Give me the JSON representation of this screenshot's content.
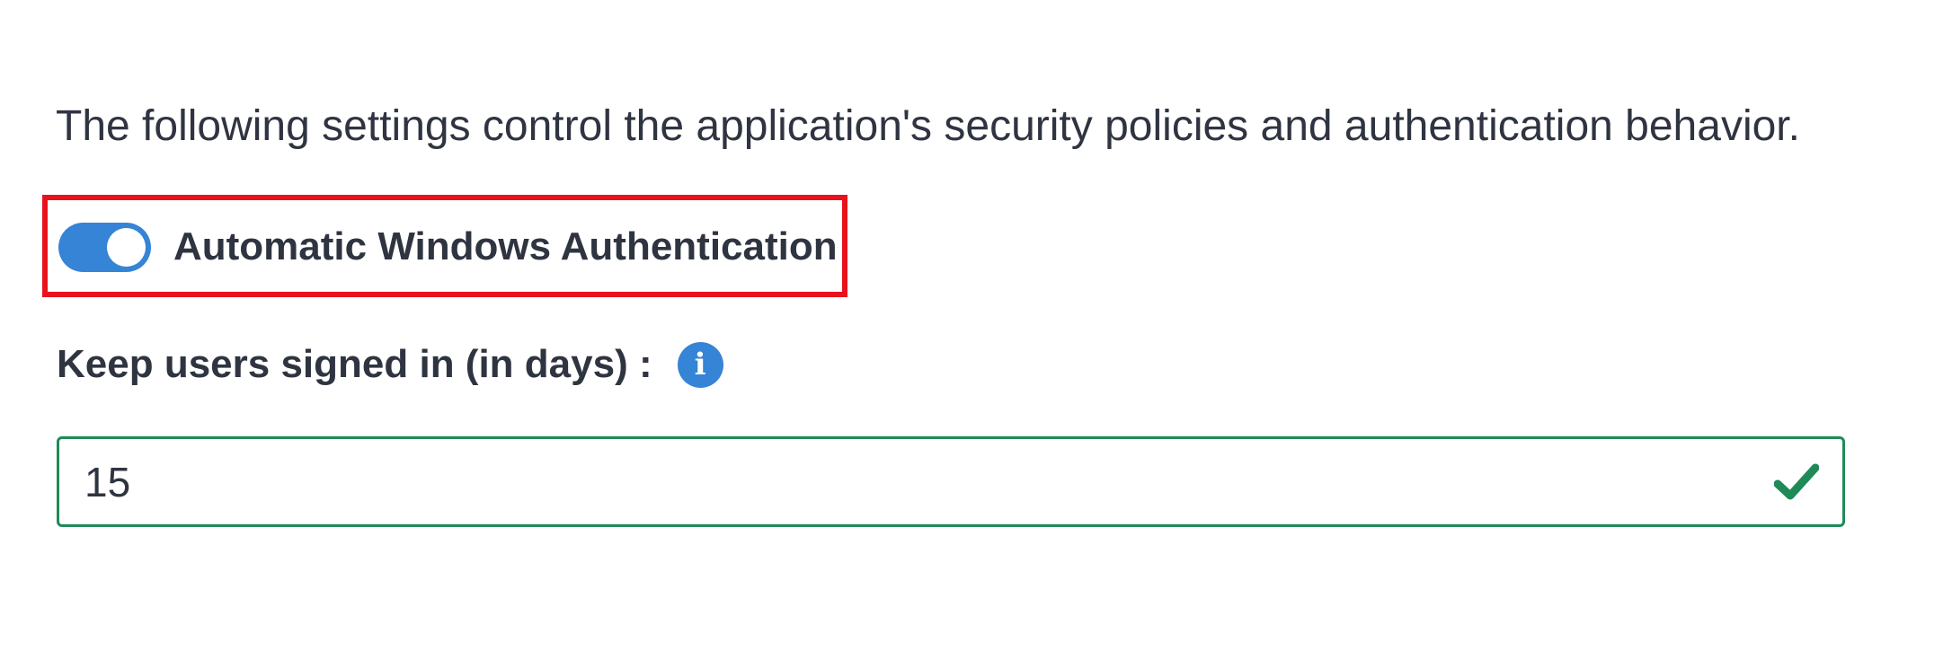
{
  "description": "The following settings control the application's security policies and authentication behavior.",
  "toggle": {
    "label": "Automatic Windows Authentication",
    "state": "on",
    "color": "#3584d6"
  },
  "highlight": {
    "color": "#e8121d"
  },
  "keep_signed_in": {
    "label": "Keep users signed in (in days) :",
    "info_icon": "info-icon",
    "value": "15",
    "valid_icon": "checkmark-icon",
    "valid_color": "#1f8a57"
  }
}
